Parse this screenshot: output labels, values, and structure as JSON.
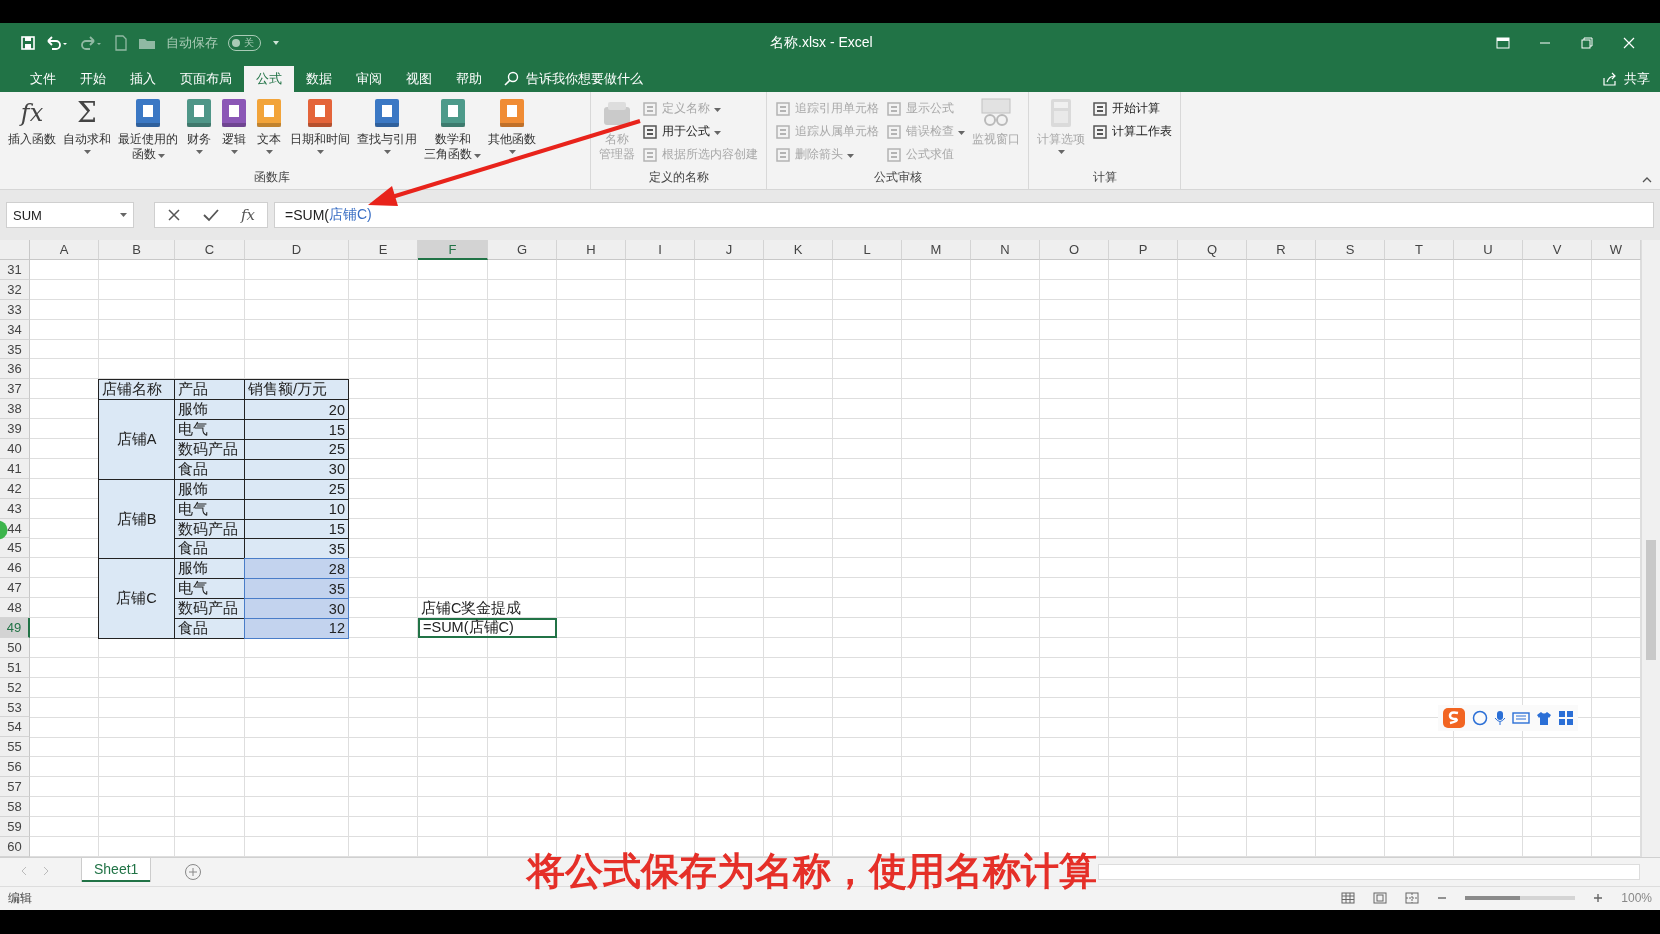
{
  "window": {
    "title": "名称.xlsx  -  Excel"
  },
  "quick_access": {
    "autosave_label": "自动保存",
    "autosave_on": false,
    "autosave_state": "关"
  },
  "ribbon_tabs": [
    {
      "label": "文件",
      "selected": false
    },
    {
      "label": "开始",
      "selected": false
    },
    {
      "label": "插入",
      "selected": false
    },
    {
      "label": "页面布局",
      "selected": false
    },
    {
      "label": "公式",
      "selected": true
    },
    {
      "label": "数据",
      "selected": false
    },
    {
      "label": "审阅",
      "selected": false
    },
    {
      "label": "视图",
      "selected": false
    },
    {
      "label": "帮助",
      "selected": false
    }
  ],
  "tell_me": "告诉我你想要做什么",
  "share": "共享",
  "ribbon_groups": [
    {
      "title": "函数库",
      "items": [
        {
          "kind": "large",
          "glyph": "fx",
          "lines": [
            "插入函数"
          ],
          "dropdown": false,
          "disabled": false
        },
        {
          "kind": "large",
          "glyph": "Σ",
          "lines": [
            "自动求和"
          ],
          "dropdown": true,
          "disabled": false
        },
        {
          "kind": "large",
          "lines": [
            "最近使用的",
            "函数"
          ],
          "dropdown": true,
          "disabled": false
        },
        {
          "kind": "large",
          "lines": [
            "财务"
          ],
          "dropdown": true,
          "disabled": false
        },
        {
          "kind": "large",
          "lines": [
            "逻辑"
          ],
          "dropdown": true,
          "disabled": false
        },
        {
          "kind": "large",
          "lines": [
            "文本"
          ],
          "dropdown": true,
          "disabled": false
        },
        {
          "kind": "large",
          "lines": [
            "日期和时间"
          ],
          "dropdown": true,
          "disabled": false
        },
        {
          "kind": "large",
          "lines": [
            "查找与引用"
          ],
          "dropdown": true,
          "disabled": false
        },
        {
          "kind": "large",
          "lines": [
            "数学和",
            "三角函数"
          ],
          "dropdown": true,
          "disabled": false
        },
        {
          "kind": "large",
          "lines": [
            "其他函数"
          ],
          "dropdown": true,
          "disabled": false
        }
      ]
    },
    {
      "title": "定义的名称",
      "items": [
        {
          "kind": "large",
          "lines": [
            "名称",
            "管理器"
          ],
          "dropdown": false,
          "disabled": true
        },
        {
          "kind": "column",
          "items": [
            {
              "label": "定义名称",
              "dropdown": true,
              "disabled": true
            },
            {
              "label": "用于公式",
              "dropdown": true,
              "disabled": false
            },
            {
              "label": "根据所选内容创建",
              "dropdown": false,
              "disabled": true
            }
          ]
        }
      ]
    },
    {
      "title": "公式审核",
      "items": [
        {
          "kind": "column",
          "items": [
            {
              "label": "追踪引用单元格",
              "dropdown": false,
              "disabled": true
            },
            {
              "label": "追踪从属单元格",
              "dropdown": false,
              "disabled": true
            },
            {
              "label": "删除箭头",
              "dropdown": true,
              "disabled": true
            }
          ]
        },
        {
          "kind": "column",
          "items": [
            {
              "label": "显示公式",
              "dropdown": false,
              "disabled": true
            },
            {
              "label": "错误检查",
              "dropdown": true,
              "disabled": true
            },
            {
              "label": "公式求值",
              "dropdown": false,
              "disabled": true
            }
          ]
        },
        {
          "kind": "large",
          "lines": [
            "监视窗口"
          ],
          "dropdown": false,
          "disabled": true
        }
      ]
    },
    {
      "title": "计算",
      "items": [
        {
          "kind": "large",
          "lines": [
            "计算选项"
          ],
          "dropdown": true,
          "disabled": true
        },
        {
          "kind": "column",
          "items": [
            {
              "label": "开始计算",
              "dropdown": false,
              "disabled": false
            },
            {
              "label": "计算工作表",
              "dropdown": false,
              "disabled": false
            }
          ]
        }
      ]
    }
  ],
  "formula_bar": {
    "name_box": "SUM",
    "fx": "fx",
    "formula": [
      {
        "kind": "plain",
        "text": "=SUM("
      },
      {
        "kind": "reference",
        "text": "店铺C)"
      }
    ]
  },
  "columns": [
    {
      "label": "A",
      "selected": false
    },
    {
      "label": "B",
      "selected": false
    },
    {
      "label": "C",
      "selected": false
    },
    {
      "label": "D",
      "selected": false
    },
    {
      "label": "E",
      "selected": false
    },
    {
      "label": "F",
      "selected": true
    },
    {
      "label": "G",
      "selected": false
    },
    {
      "label": "H",
      "selected": false
    },
    {
      "label": "I",
      "selected": false
    },
    {
      "label": "J",
      "selected": false
    },
    {
      "label": "K",
      "selected": false
    },
    {
      "label": "L",
      "selected": false
    },
    {
      "label": "M",
      "selected": false
    },
    {
      "label": "N",
      "selected": false
    },
    {
      "label": "O",
      "selected": false
    },
    {
      "label": "P",
      "selected": false
    },
    {
      "label": "Q",
      "selected": false
    },
    {
      "label": "R",
      "selected": false
    },
    {
      "label": "S",
      "selected": false
    },
    {
      "label": "T",
      "selected": false
    },
    {
      "label": "U",
      "selected": false
    },
    {
      "label": "V",
      "selected": false
    },
    {
      "label": "W",
      "selected": false
    }
  ],
  "rows": [
    {
      "label": "31",
      "selected": false
    },
    {
      "label": "32",
      "selected": false
    },
    {
      "label": "33",
      "selected": false
    },
    {
      "label": "34",
      "selected": false
    },
    {
      "label": "35",
      "selected": false
    },
    {
      "label": "36",
      "selected": false
    },
    {
      "label": "37",
      "selected": false
    },
    {
      "label": "38",
      "selected": false
    },
    {
      "label": "39",
      "selected": false
    },
    {
      "label": "40",
      "selected": false
    },
    {
      "label": "41",
      "selected": false
    },
    {
      "label": "42",
      "selected": false
    },
    {
      "label": "43",
      "selected": false
    },
    {
      "label": "44",
      "selected": false
    },
    {
      "label": "45",
      "selected": false
    },
    {
      "label": "46",
      "selected": false
    },
    {
      "label": "47",
      "selected": false
    },
    {
      "label": "48",
      "selected": false
    },
    {
      "label": "49",
      "selected": true
    },
    {
      "label": "50",
      "selected": false
    },
    {
      "label": "51",
      "selected": false
    },
    {
      "label": "52",
      "selected": false
    },
    {
      "label": "53",
      "selected": false
    },
    {
      "label": "54",
      "selected": false
    },
    {
      "label": "55",
      "selected": false
    },
    {
      "label": "56",
      "selected": false
    },
    {
      "label": "57",
      "selected": false
    },
    {
      "label": "58",
      "selected": false
    },
    {
      "label": "59",
      "selected": false
    },
    {
      "label": "60",
      "selected": false
    }
  ],
  "sales_table": {
    "headers": [
      "店铺名称",
      "产品",
      "销售额/万元"
    ],
    "stores": [
      {
        "name": "店铺A",
        "items": [
          {
            "product": "服饰",
            "sales": "20",
            "selected": false
          },
          {
            "product": "电气",
            "sales": "15",
            "selected": false
          },
          {
            "product": "数码产品",
            "sales": "25",
            "selected": false
          },
          {
            "product": "食品",
            "sales": "30",
            "selected": false
          }
        ]
      },
      {
        "name": "店铺B",
        "items": [
          {
            "product": "服饰",
            "sales": "25",
            "selected": false
          },
          {
            "product": "电气",
            "sales": "10",
            "selected": false
          },
          {
            "product": "数码产品",
            "sales": "15",
            "selected": false
          },
          {
            "product": "食品",
            "sales": "35",
            "selected": false
          }
        ]
      },
      {
        "name": "店铺C",
        "items": [
          {
            "product": "服饰",
            "sales": "28",
            "selected": true
          },
          {
            "product": "电气",
            "sales": "35",
            "selected": true
          },
          {
            "product": "数码产品",
            "sales": "30",
            "selected": true
          },
          {
            "product": "食品",
            "sales": "12",
            "selected": true
          }
        ]
      }
    ]
  },
  "notes": [
    {
      "kind": "text",
      "text": "店铺C奖金提成"
    },
    {
      "kind": "editing",
      "text": "=SUM(店铺C)"
    }
  ],
  "sheet_tabs": [
    {
      "label": "Sheet1",
      "selected": true
    }
  ],
  "status_bar": {
    "mode": "编辑",
    "zoom": "100%",
    "zoom_slider": {
      "level": 0.5
    }
  },
  "caption": "将公式保存为名称，使用名称计算"
}
